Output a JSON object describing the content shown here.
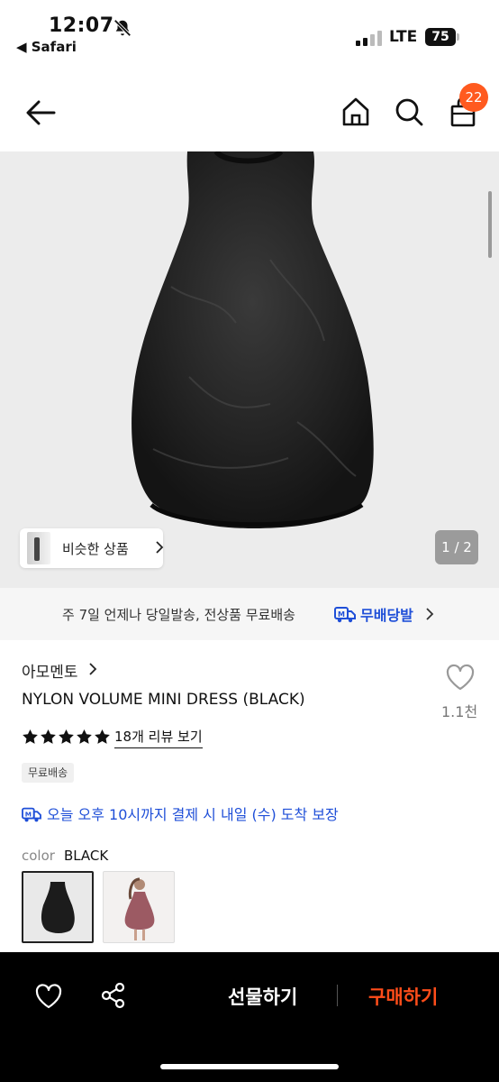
{
  "status_bar": {
    "time": "12:07",
    "back_app": "◀ Safari",
    "network": "LTE",
    "battery": "75"
  },
  "header": {
    "cart_count": "22",
    "icons": [
      "back-arrow-icon",
      "home-icon",
      "search-icon",
      "cart-icon"
    ]
  },
  "gallery": {
    "similar_label": "비슷한 상품",
    "page_indicator": "1 / 2"
  },
  "delivery_banner": {
    "text": "주 7일 언제나 당일발송, 전상품 무료배송",
    "brand": "무배당발"
  },
  "product": {
    "brand": "아모멘토",
    "title": "NYLON VOLUME MINI DRESS (BLACK)",
    "like_count": "1.1천",
    "rating_stars": 5,
    "review_link": "18개 리뷰 보기",
    "tag": "무료배송",
    "arrival_notice": "오늘 오후 10시까지 결제 시 내일 (수) 도착 보장",
    "color_label": "color",
    "color_value": "BLACK"
  },
  "bottom_bar": {
    "gift_label": "선물하기",
    "buy_label": "구매하기"
  },
  "colors": {
    "accent_orange": "#ff5a1f",
    "buy_orange": "#ff4d1a",
    "delivery_blue": "#1f4fd8"
  }
}
